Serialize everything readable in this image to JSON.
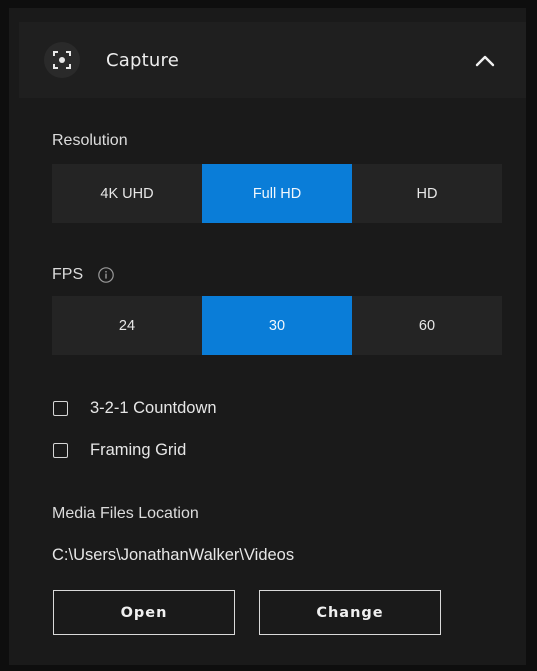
{
  "header": {
    "title": "Capture",
    "icon": "capture-focus-icon",
    "collapse_icon": "chevron-up-icon"
  },
  "resolution": {
    "label": "Resolution",
    "options": [
      "4K UHD",
      "Full HD",
      "HD"
    ],
    "selected": "Full HD"
  },
  "fps": {
    "label": "FPS",
    "info_icon": "info-icon",
    "options": [
      "24",
      "30",
      "60"
    ],
    "selected": "30"
  },
  "checkboxes": [
    {
      "label": "3-2-1 Countdown",
      "checked": false
    },
    {
      "label": "Framing Grid",
      "checked": false
    }
  ],
  "media": {
    "label": "Media Files Location",
    "path": "C:\\Users\\JonathanWalker\\Videos",
    "open_label": "Open",
    "change_label": "Change"
  },
  "colors": {
    "accent": "#0a7dd8",
    "panel_bg": "#1a1a1a",
    "segment_bg": "#242424"
  }
}
